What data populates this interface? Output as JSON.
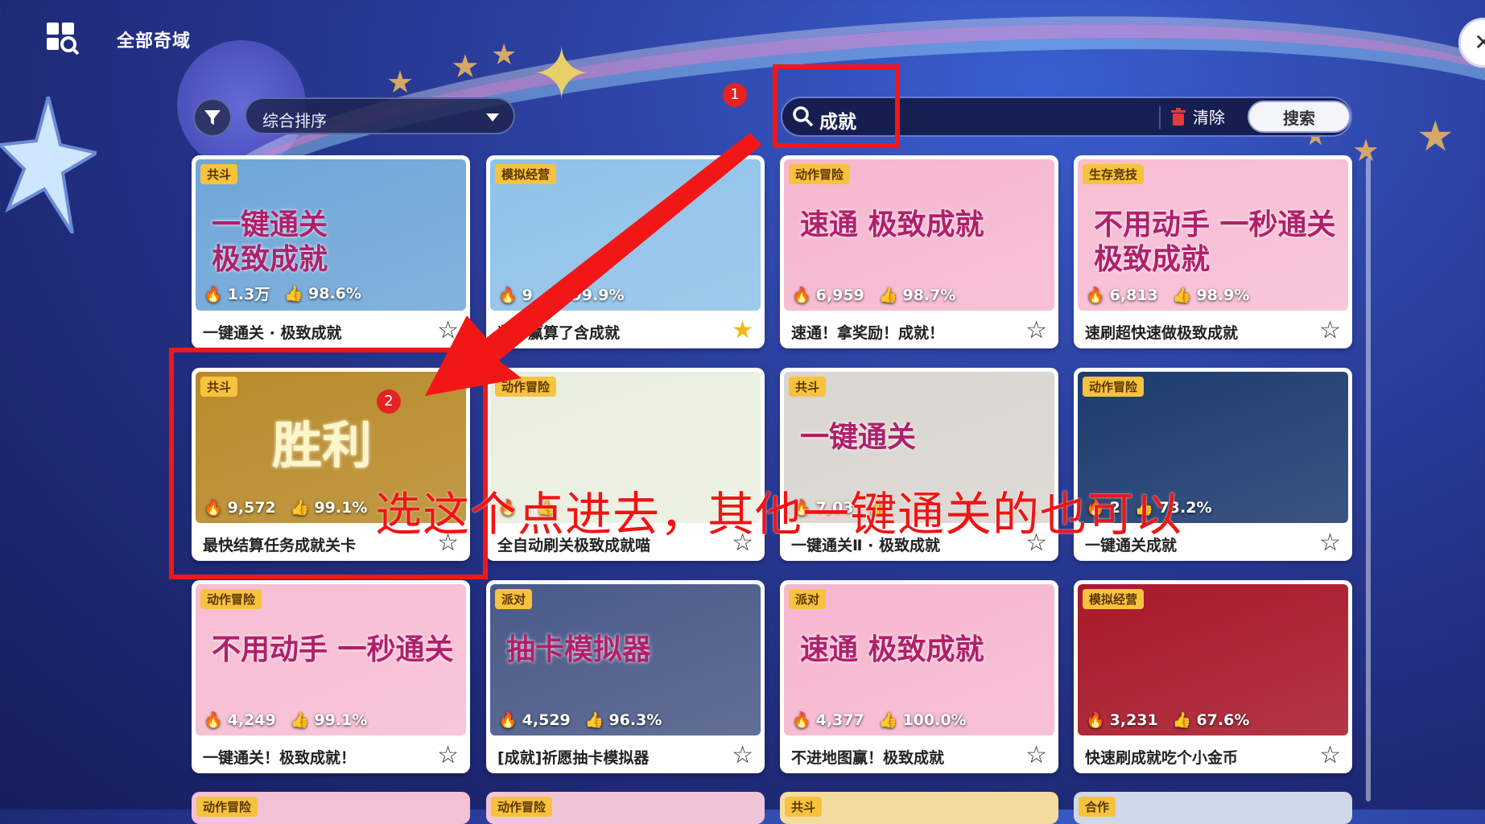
{
  "header": {
    "title": "全部奇域",
    "sort_label": "综合排序",
    "search_value": "成就",
    "clear_label": "清除",
    "search_button": "搜索"
  },
  "annotations": {
    "step1": "1",
    "step2": "2",
    "instruction": "选这个点进去，其他一键通关的也可以"
  },
  "cards": [
    {
      "tag": "共斗",
      "plays": "1.3万",
      "like": "98.6%",
      "title": "一键通关 · 极致成就",
      "fav": false,
      "art": "一键通关\n极致成就",
      "bg": "#6fa6d8"
    },
    {
      "tag": "模拟经营",
      "plays": "9",
      "like": "99.9%",
      "title": "判你赢算了含成就",
      "fav": true,
      "art": "",
      "bg": "#8fc2e8"
    },
    {
      "tag": "动作冒险",
      "plays": "6,959",
      "like": "98.7%",
      "title": "速通！拿奖励！成就！",
      "fav": false,
      "art": "速通 极致成就",
      "bg": "#f6b7cf"
    },
    {
      "tag": "生存竞技",
      "plays": "6,813",
      "like": "98.9%",
      "title": "速刷超快速做极致成就",
      "fav": false,
      "art": "不用动手 一秒通关 极致成就",
      "bg": "#f7bdd3"
    },
    {
      "tag": "共斗",
      "plays": "9,572",
      "like": "99.1%",
      "title": "最快结算任务成就关卡",
      "fav": false,
      "art": "胜利",
      "bg": "#b88a2a"
    },
    {
      "tag": "动作冒险",
      "plays": "",
      "like": "",
      "title": "全自动刷关极致成就喵",
      "fav": false,
      "art": "",
      "bg": "#e9efe0"
    },
    {
      "tag": "共斗",
      "plays": "7,03",
      "like": "",
      "title": "一键通关Ⅱ · 极致成就",
      "fav": false,
      "art": "一键通关",
      "bg": "#d9d5d0"
    },
    {
      "tag": "动作冒险",
      "plays": "2",
      "like": "73.2%",
      "title": "一键通关成就",
      "fav": false,
      "art": "",
      "bg": "#1d3b6e"
    },
    {
      "tag": "动作冒险",
      "plays": "4,249",
      "like": "99.1%",
      "title": "一键通关！极致成就！",
      "fav": false,
      "art": "不用动手 一秒通关",
      "bg": "#f7bdd3"
    },
    {
      "tag": "派对",
      "plays": "4,529",
      "like": "96.3%",
      "title": "[成就]祈愿抽卡模拟器",
      "fav": false,
      "art": "抽卡模拟器",
      "bg": "#4a5a88"
    },
    {
      "tag": "派对",
      "plays": "4,377",
      "like": "100.0%",
      "title": "不进地图赢！极致成就",
      "fav": false,
      "art": "速通 极致成就",
      "bg": "#f6b7cf"
    },
    {
      "tag": "模拟经营",
      "plays": "3,231",
      "like": "67.6%",
      "title": "快速刷成就吃个小金币",
      "fav": false,
      "art": "",
      "bg": "#a8182a"
    }
  ],
  "bottom_tags": [
    "动作冒险",
    "动作冒险",
    "共斗",
    "合作"
  ],
  "colors": {
    "accent_red": "#f21717",
    "tag_yellow": "#f7c23e",
    "fav_gold": "#f5b715"
  },
  "icons": [
    "menu-search-icon",
    "filter-icon",
    "chevron-down-icon",
    "search-icon",
    "trash-icon",
    "fire-icon",
    "thumbs-up-icon",
    "star-icon",
    "compass-icon"
  ]
}
